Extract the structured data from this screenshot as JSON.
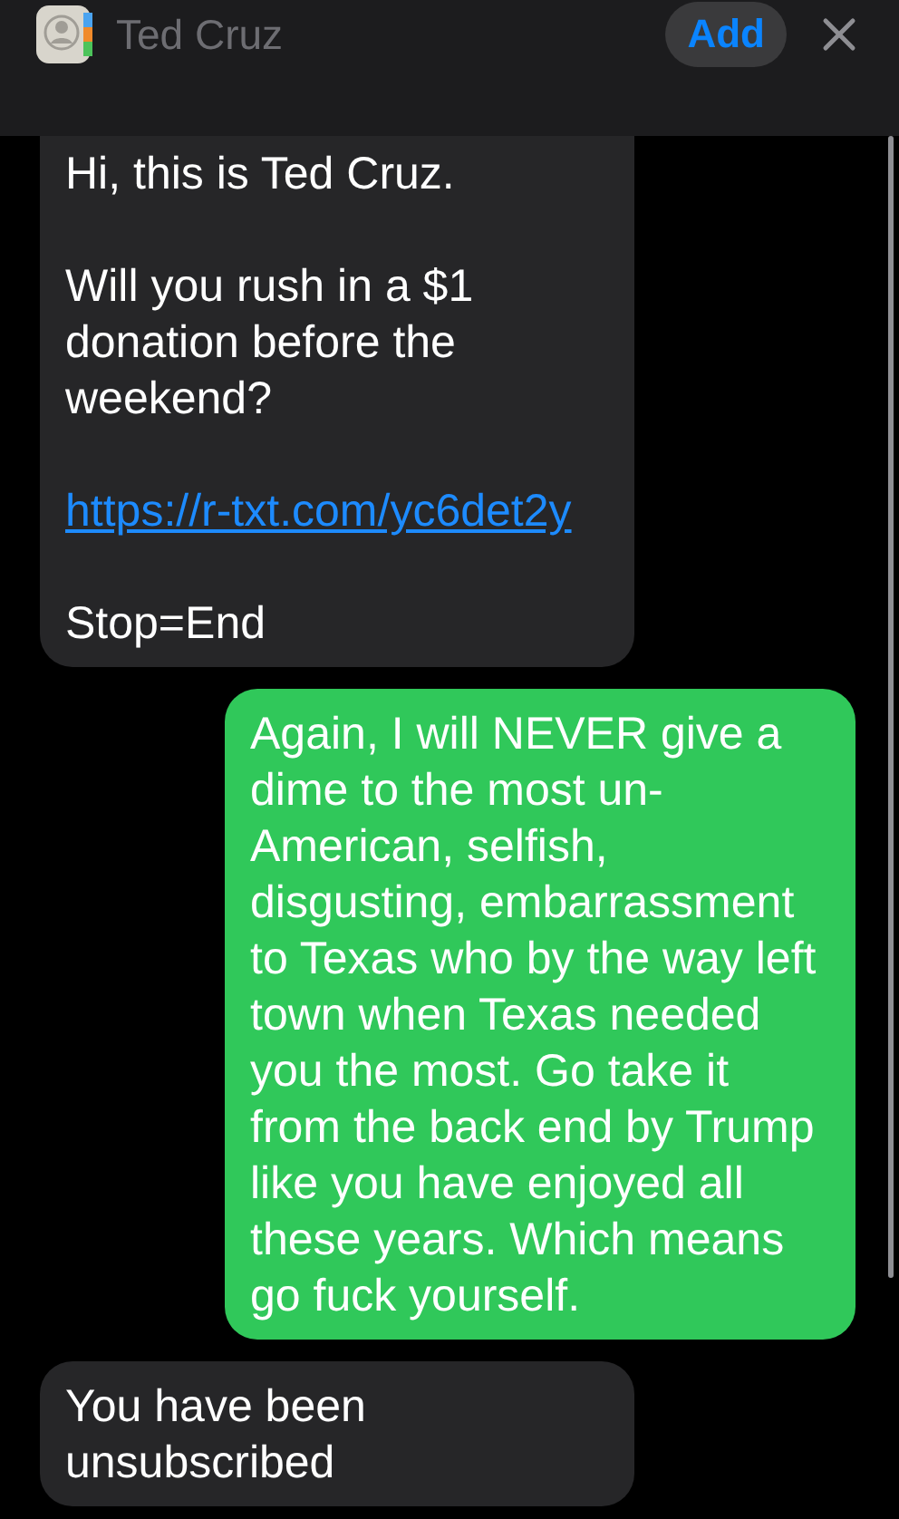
{
  "header": {
    "contact_name": "Ted Cruz",
    "add_button": "Add"
  },
  "messages": [
    {
      "kind": "incoming",
      "clipped": true,
      "parts": [
        {
          "kind": "text",
          "text": "Hi, this is Ted Cruz."
        },
        {
          "kind": "text",
          "text": "Will you rush in a $1 donation before the weekend?"
        },
        {
          "kind": "link",
          "text": "https://r-txt.com/yc6det2y"
        },
        {
          "kind": "text",
          "text": "Stop=End"
        }
      ]
    },
    {
      "kind": "outgoing",
      "clipped": false,
      "parts": [
        {
          "kind": "text",
          "text": "Again, I will NEVER give a dime to the most un-American, selfish, disgusting, embarrassment to Texas who by the way left town when Texas needed you the most. Go take it from the back end by Trump like you have enjoyed all these years. Which means go fuck yourself."
        }
      ]
    },
    {
      "kind": "incoming",
      "clipped": false,
      "parts": [
        {
          "kind": "text",
          "text": "You have been unsubscribed"
        }
      ]
    }
  ]
}
